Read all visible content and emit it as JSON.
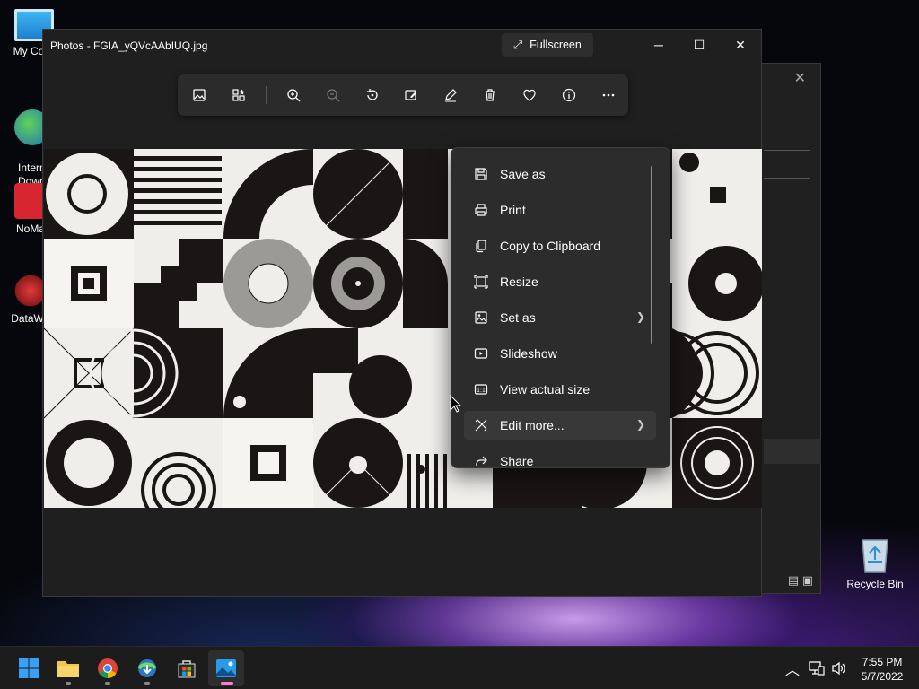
{
  "desktop": {
    "icons": [
      {
        "label": "My Com"
      },
      {
        "label": "Intern\nDownl"
      },
      {
        "label": "NoMac"
      },
      {
        "label": "DataWag"
      }
    ],
    "recycle_bin": "Recycle Bin"
  },
  "photos": {
    "title": "Photos - FGIA_yQVcAAbIUQ.jpg",
    "fullscreen_label": "Fullscreen",
    "toolbar_icons": [
      "image-icon",
      "apps-icon",
      "zoom-in-icon",
      "zoom-out-icon",
      "rotate-icon",
      "edit-image-icon",
      "draw-icon",
      "delete-icon",
      "favorite-icon",
      "info-icon",
      "more-icon"
    ]
  },
  "menu": {
    "items": [
      {
        "label": "Save as",
        "icon": "save-icon",
        "submenu": false
      },
      {
        "label": "Print",
        "icon": "print-icon",
        "submenu": false
      },
      {
        "label": "Copy to Clipboard",
        "icon": "copy-icon",
        "submenu": false
      },
      {
        "label": "Resize",
        "icon": "resize-icon",
        "submenu": false
      },
      {
        "label": "Set as",
        "icon": "set-as-icon",
        "submenu": true
      },
      {
        "label": "Slideshow",
        "icon": "slideshow-icon",
        "submenu": false
      },
      {
        "label": "View actual size",
        "icon": "actual-size-icon",
        "submenu": false
      },
      {
        "label": "Edit more...",
        "icon": "edit-more-icon",
        "submenu": true,
        "highlighted": true
      },
      {
        "label": "Share",
        "icon": "share-icon",
        "submenu": false
      }
    ]
  },
  "taskbar": {
    "time": "7:55 PM",
    "date": "5/7/2022"
  },
  "colors": {
    "accent": "#ff7ad0",
    "menu_bg": "#2c2c2c",
    "window_bg": "#1f1f1f"
  }
}
